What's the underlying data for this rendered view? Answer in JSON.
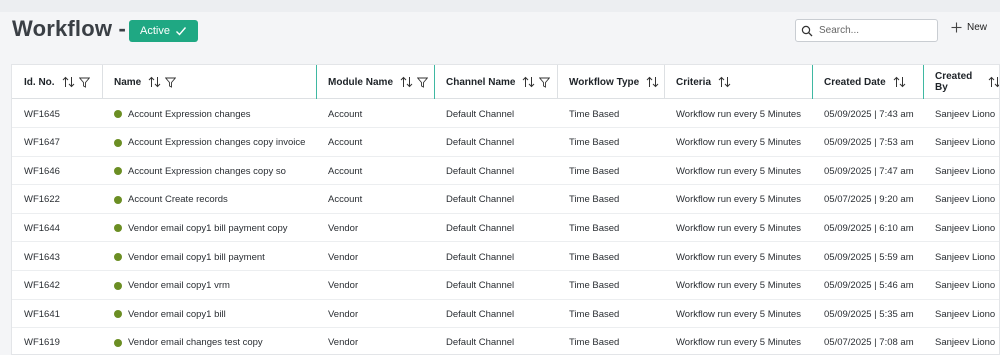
{
  "page": {
    "title": "Workflow -",
    "status_label": "Active",
    "search_placeholder": "Search...",
    "new_label": "New"
  },
  "columns": [
    {
      "key": "id",
      "label": "Id. No.",
      "sort": true,
      "filter": true
    },
    {
      "key": "name",
      "label": "Name",
      "sort": true,
      "filter": true
    },
    {
      "key": "module",
      "label": "Module Name",
      "sort": true,
      "filter": true
    },
    {
      "key": "channel",
      "label": "Channel Name",
      "sort": true,
      "filter": true
    },
    {
      "key": "type",
      "label": "Workflow Type",
      "sort": true,
      "filter": false
    },
    {
      "key": "criteria",
      "label": "Criteria",
      "sort": true,
      "filter": false
    },
    {
      "key": "created",
      "label": "Created Date",
      "sort": true,
      "filter": false
    },
    {
      "key": "by",
      "label": "Created By",
      "sort": true,
      "filter": false
    }
  ],
  "rows": [
    {
      "id": "WF1645",
      "name": "Account Expression changes",
      "module": "Account",
      "channel": "Default Channel",
      "type": "Time Based",
      "criteria": "Workflow run every 5 Minutes",
      "created": "05/09/2025 | 7:43 am",
      "by": "Sanjeev Liono"
    },
    {
      "id": "WF1647",
      "name": "Account Expression changes copy invoice",
      "module": "Account",
      "channel": "Default Channel",
      "type": "Time Based",
      "criteria": "Workflow run every 5 Minutes",
      "created": "05/09/2025 | 7:53 am",
      "by": "Sanjeev Liono"
    },
    {
      "id": "WF1646",
      "name": "Account Expression changes copy so",
      "module": "Account",
      "channel": "Default Channel",
      "type": "Time Based",
      "criteria": "Workflow run every 5 Minutes",
      "created": "05/09/2025 | 7:47 am",
      "by": "Sanjeev Liono"
    },
    {
      "id": "WF1622",
      "name": "Account Create records",
      "module": "Account",
      "channel": "Default Channel",
      "type": "Time Based",
      "criteria": "Workflow run every 5 Minutes",
      "created": "05/07/2025 | 9:20 am",
      "by": "Sanjeev Liono"
    },
    {
      "id": "WF1644",
      "name": "Vendor email copy1 bill payment copy",
      "module": "Vendor",
      "channel": "Default Channel",
      "type": "Time Based",
      "criteria": "Workflow run every 5 Minutes",
      "created": "05/09/2025 | 6:10 am",
      "by": "Sanjeev Liono"
    },
    {
      "id": "WF1643",
      "name": "Vendor email copy1 bill payment",
      "module": "Vendor",
      "channel": "Default Channel",
      "type": "Time Based",
      "criteria": "Workflow run every 5 Minutes",
      "created": "05/09/2025 | 5:59 am",
      "by": "Sanjeev Liono"
    },
    {
      "id": "WF1642",
      "name": "Vendor email copy1 vrm",
      "module": "Vendor",
      "channel": "Default Channel",
      "type": "Time Based",
      "criteria": "Workflow run every 5 Minutes",
      "created": "05/09/2025 | 5:46 am",
      "by": "Sanjeev Liono"
    },
    {
      "id": "WF1641",
      "name": "Vendor email copy1 bill",
      "module": "Vendor",
      "channel": "Default Channel",
      "type": "Time Based",
      "criteria": "Workflow run every 5 Minutes",
      "created": "05/09/2025 | 5:35 am",
      "by": "Sanjeev Liono"
    },
    {
      "id": "WF1619",
      "name": "Vendor email changes test copy",
      "module": "Vendor",
      "channel": "Default Channel",
      "type": "Time Based",
      "criteria": "Workflow run every 5 Minutes",
      "created": "05/07/2025 | 7:08 am",
      "by": "Sanjeev Liono"
    }
  ],
  "colors": {
    "accent": "#1fa883",
    "status_dot": "#6b8e23",
    "column_divider_accent": "#3fb8a2"
  },
  "icons": {
    "status": "check-icon",
    "search": "search-icon",
    "new": "plus-icon",
    "sort": "sort-arrows-icon",
    "filter": "filter-icon",
    "row_status": "status-dot"
  }
}
